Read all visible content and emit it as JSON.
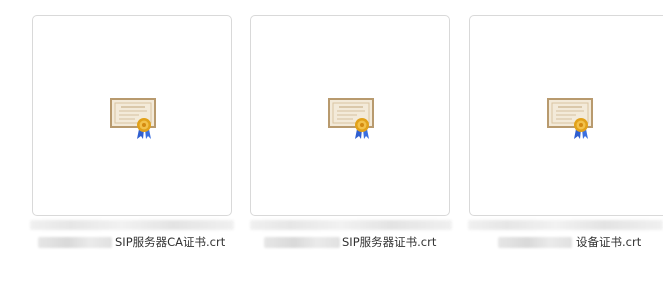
{
  "files": [
    {
      "name": "SIP服务器CA证书.crt",
      "icon": "certificate-icon"
    },
    {
      "name": "SIP服务器证书.crt",
      "icon": "certificate-icon"
    },
    {
      "name": "设备证书.crt",
      "icon": "certificate-icon"
    }
  ],
  "colors": {
    "card_border": "#d9d9d9",
    "cert_paper": "#f3ead9",
    "cert_frame": "#b89a6e",
    "seal_gold": "#e1a11a",
    "ribbon_blue": "#2f5fd0",
    "text": "#333333"
  }
}
